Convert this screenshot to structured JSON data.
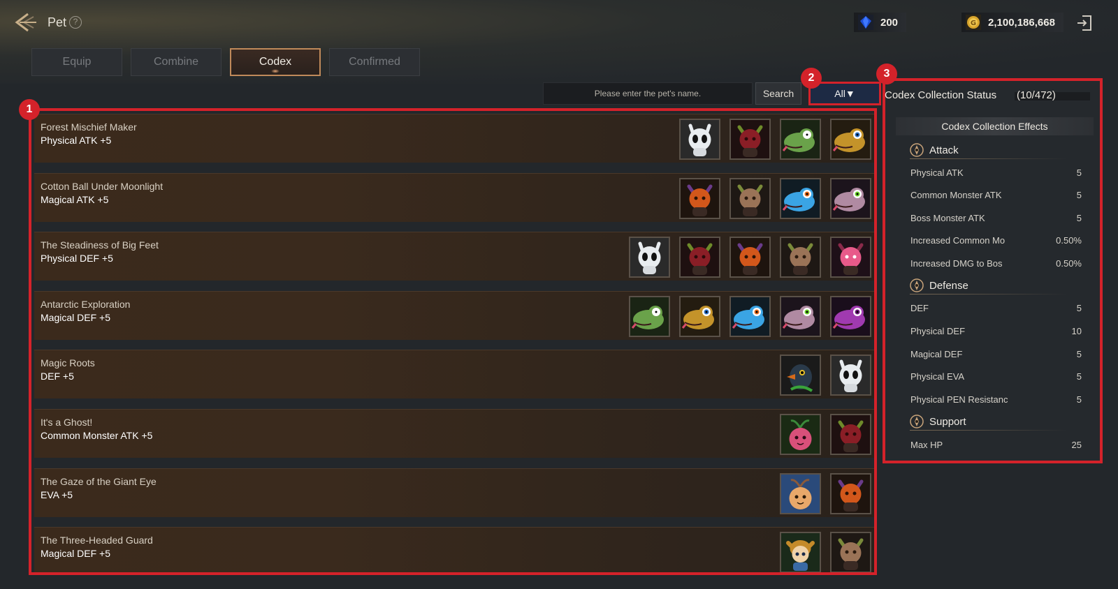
{
  "header": {
    "title": "Pet",
    "gems": "200",
    "gold": "2,100,186,668"
  },
  "tabs": [
    "Equip",
    "Combine",
    "Codex",
    "Confirmed"
  ],
  "active_tab": "Codex",
  "search": {
    "placeholder": "Please enter the pet's name.",
    "button": "Search"
  },
  "filter": {
    "value": "All▼"
  },
  "callouts": [
    "1",
    "2",
    "3"
  ],
  "codex_list": [
    {
      "title": "Forest Mischief Maker",
      "effect": "Physical ATK +5",
      "pets": [
        "ghost",
        "redgoblin",
        "greenlizard",
        "yellowlizard"
      ]
    },
    {
      "title": "Cotton Ball Under Moonlight",
      "effect": "Magical ATK +5",
      "pets": [
        "orangegoblin",
        "browngoblin",
        "bluelizard",
        "purplelizard"
      ]
    },
    {
      "title": "The Steadiness of Big Feet",
      "effect": "Physical DEF +5",
      "pets": [
        "ghost",
        "redgoblin",
        "orangegoblin",
        "browngoblin",
        "pinkgoblin"
      ]
    },
    {
      "title": "Antarctic Exploration",
      "effect": "Magical DEF +5",
      "pets": [
        "greenlizard",
        "yellowlizard",
        "bluelizard",
        "purplelizard",
        "violetlizard"
      ]
    },
    {
      "title": "Magic Roots",
      "effect": "DEF +5",
      "pets": [
        "bird",
        "ghost"
      ]
    },
    {
      "title": "It's a Ghost!",
      "effect": "Common Monster ATK +5",
      "pets": [
        "pinksprout",
        "redgoblin"
      ]
    },
    {
      "title": "The Gaze of the Giant Eye",
      "effect": "EVA +5",
      "pets": [
        "sprout",
        "orangegoblin"
      ]
    },
    {
      "title": "The Three-Headed Guard",
      "effect": "Magical DEF +5",
      "pets": [
        "girl",
        "browngoblin"
      ]
    }
  ],
  "status": {
    "title": "Codex Collection Status",
    "count": "(10/472)",
    "effects_header": "Codex Collection Effects",
    "sections": [
      {
        "name": "Attack",
        "stats": [
          {
            "label": "Physical ATK",
            "value": "5"
          },
          {
            "label": "Common Monster ATK",
            "value": "5"
          },
          {
            "label": "Boss Monster ATK",
            "value": "5"
          },
          {
            "label": "Increased Common Mo",
            "value": "0.50%"
          },
          {
            "label": "Increased DMG to Bos",
            "value": "0.50%"
          }
        ]
      },
      {
        "name": "Defense",
        "stats": [
          {
            "label": "DEF",
            "value": "5"
          },
          {
            "label": "Physical DEF",
            "value": "10"
          },
          {
            "label": "Magical DEF",
            "value": "5"
          },
          {
            "label": "Physical EVA",
            "value": "5"
          },
          {
            "label": "Physical PEN Resistanc",
            "value": "5"
          }
        ]
      },
      {
        "name": "Support",
        "stats": [
          {
            "label": "Max HP",
            "value": "25"
          }
        ]
      }
    ]
  },
  "colors": {
    "highlight": "#d4222a",
    "tab_active_border": "#c08a5a",
    "row_bg": "#3b2a1c",
    "panel_bg": "#25292d"
  }
}
